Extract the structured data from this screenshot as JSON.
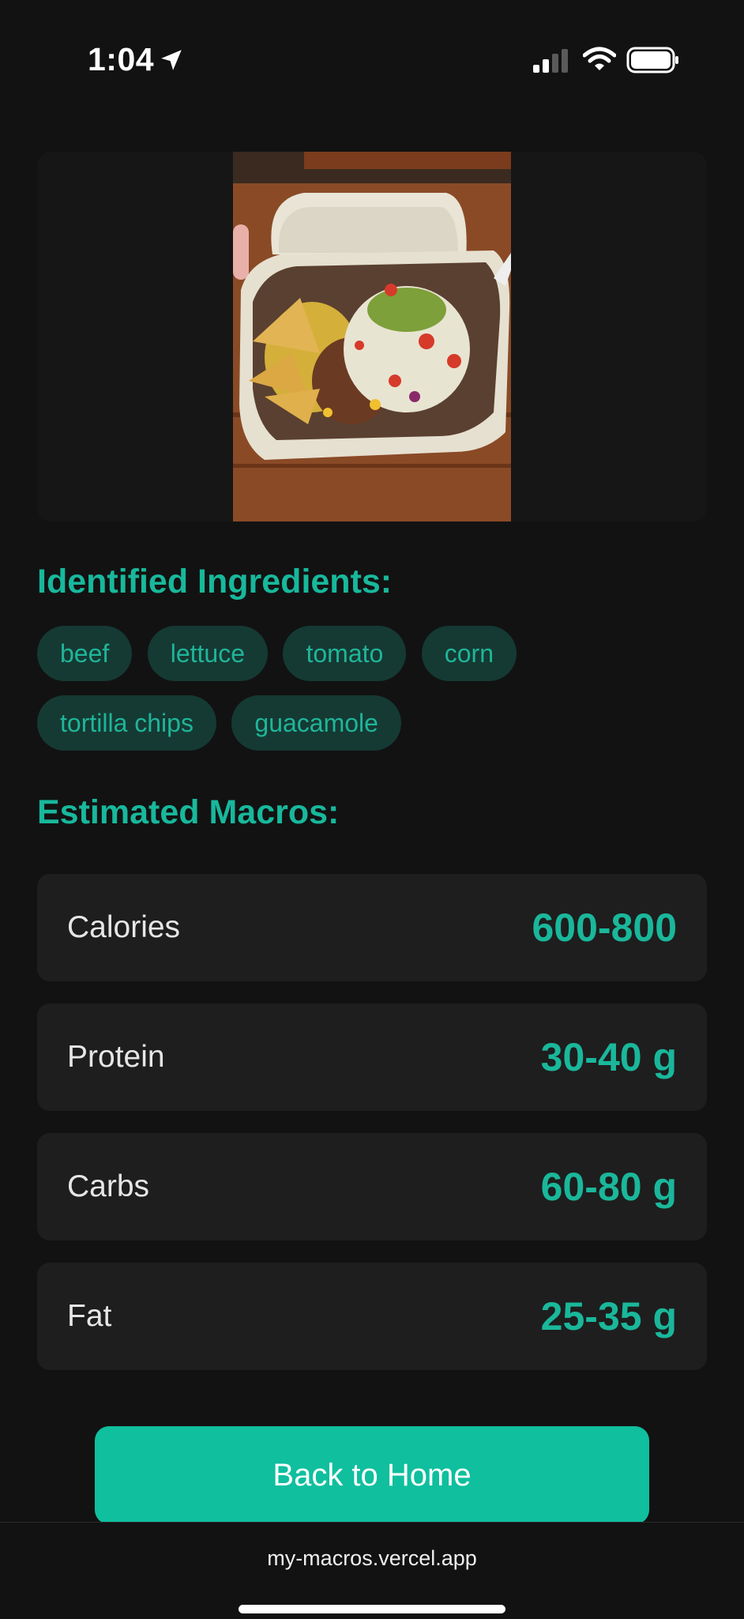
{
  "status_bar": {
    "time": "1:04",
    "icons": [
      "location-arrow-icon",
      "cellular-signal-icon",
      "wifi-icon",
      "battery-icon"
    ]
  },
  "photo": {
    "alt": "food-photo"
  },
  "ingredients": {
    "title": "Identified Ingredients:",
    "items": [
      "beef",
      "lettuce",
      "tomato",
      "corn",
      "tortilla chips",
      "guacamole"
    ]
  },
  "macros": {
    "title": "Estimated Macros:",
    "items": [
      {
        "label": "Calories",
        "value": "600-800"
      },
      {
        "label": "Protein",
        "value": "30-40 g"
      },
      {
        "label": "Carbs",
        "value": "60-80 g"
      },
      {
        "label": "Fat",
        "value": "25-35 g"
      }
    ]
  },
  "actions": {
    "back_label": "Back to Home"
  },
  "browser": {
    "url": "my-macros.vercel.app"
  },
  "colors": {
    "accent": "#18b89c",
    "chip_bg": "#153a33",
    "card_bg": "#1e1e1e",
    "page_bg": "#121212",
    "button_bg": "#0fbf9e"
  }
}
